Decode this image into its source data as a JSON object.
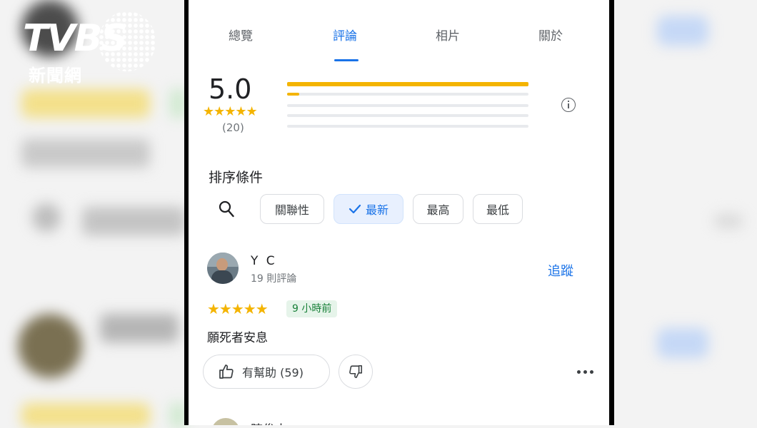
{
  "logo": {
    "wordmark": "TVBS",
    "subtitle": "新聞網"
  },
  "tabs": [
    {
      "label": "總覽"
    },
    {
      "label": "評論"
    },
    {
      "label": "相片"
    },
    {
      "label": "關於"
    }
  ],
  "active_tab": "評論",
  "summary": {
    "rating": "5.0",
    "stars": "★★★★★",
    "count": "(20)",
    "distribution": [
      {
        "stars": 5,
        "fraction": 1.0
      },
      {
        "stars": 4,
        "fraction": 0.05
      },
      {
        "stars": 3,
        "fraction": 0
      },
      {
        "stars": 2,
        "fraction": 0
      },
      {
        "stars": 1,
        "fraction": 0
      }
    ]
  },
  "sort": {
    "label": "排序條件",
    "options": [
      {
        "label": "關聯性",
        "selected": false
      },
      {
        "label": "最新",
        "selected": true
      },
      {
        "label": "最高",
        "selected": false
      },
      {
        "label": "最低",
        "selected": false
      }
    ]
  },
  "review": {
    "name": "Y C",
    "meta": "19 則評論",
    "follow": "追蹤",
    "stars": "★★★★★",
    "rating": 5,
    "time": "9 小時前",
    "text": "願死者安息",
    "helpful": "有幫助 (59)"
  },
  "next_review": {
    "name": "陳俊杰"
  },
  "colors": {
    "accent": "#1a73e8",
    "star": "#f4b400",
    "time_badge_bg": "#e6f4ea",
    "time_badge_text": "#188038"
  }
}
